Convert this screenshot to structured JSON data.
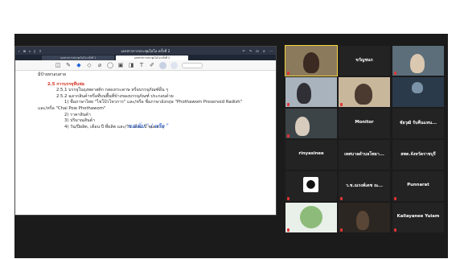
{
  "app": {
    "window_title": "เอกสารการประชุมไอโอ ครั้งที่ 2",
    "tabs": [
      "เอกสารการประชุมไอโอ ครั้งที่ 1",
      "เอกสารการประชุมไอโอ ครั้งที่ 2"
    ]
  },
  "document": {
    "line_intro": "มีป้ายหรอบสาย",
    "heading": "2.5 การบรรจุหีบห่อ",
    "item_251": "2.5.1 บรรจุในถุงพลาสติก กล่องกระดาษ หรือบรรจุภัณฑ์อื่น ๆ",
    "item_252": "2.5.2 ฉลากสินค้าหรือที่บนพื้นที่ข้างของบรรจุภัณฑ์ ประกอบด้วย",
    "sub_1": "1) ชื่อภาษาไทย \"ไชโป้วไหวการ\" และ/หรือ ชื่อภาษาอังกฤษ \"Phothawom Preserved Radish\"",
    "sub_1_cont": "และ/หรือ \"Chai Pow Phothawom\"",
    "sub_2": "2) ราคาสินค้า",
    "sub_3": "3) ปริมาณสินค้า",
    "sub_4": "4) วัน/ปีผลิต, เดือน ปี ที่ผลิต และ/วัน เดือน ปี หมดอายุ",
    "handwriting": "ขอเพิ่ม  \" / หรือ \""
  },
  "participants": [
    {
      "name": "",
      "sub": "",
      "video": true,
      "speaking": true
    },
    {
      "name": "ขวัญชนก",
      "sub": "",
      "video": false
    },
    {
      "name": "",
      "sub": "",
      "video": true
    },
    {
      "name": "",
      "sub": "",
      "video": true
    },
    {
      "name": "",
      "sub": "",
      "video": true
    },
    {
      "name": "",
      "sub": "",
      "video": true
    },
    {
      "name": "",
      "sub": "",
      "video": true
    },
    {
      "name": "Monitor",
      "sub": "",
      "video": false
    },
    {
      "name": "ชัยวุฒิ รับคืนแหน...",
      "sub": "",
      "video": false
    },
    {
      "name": "rinyasinee",
      "sub": "",
      "video": false
    },
    {
      "name": "เทศบาลตำบลโพธา...",
      "sub": "",
      "video": false
    },
    {
      "name": "สพต.จังหวัดราชบุรี",
      "sub": "",
      "video": false
    },
    {
      "name": "",
      "sub": "",
      "video": false,
      "logo": ""
    },
    {
      "name": "ว.ช.ณรงค์เดช ณ...",
      "sub": "",
      "video": false
    },
    {
      "name": "Punnarat",
      "sub": "",
      "video": false
    },
    {
      "name": "",
      "sub": "",
      "video": true
    },
    {
      "name": "",
      "sub": "",
      "video": true
    },
    {
      "name": "Kallayanee Yuiam",
      "sub": "",
      "video": false
    }
  ],
  "icons": [
    "back-icon",
    "forward-icon",
    "undo-icon",
    "redo-icon",
    "pen-icon",
    "highlighter-icon",
    "eraser-icon",
    "shape-icon",
    "image-icon",
    "apple-logo-icon"
  ]
}
